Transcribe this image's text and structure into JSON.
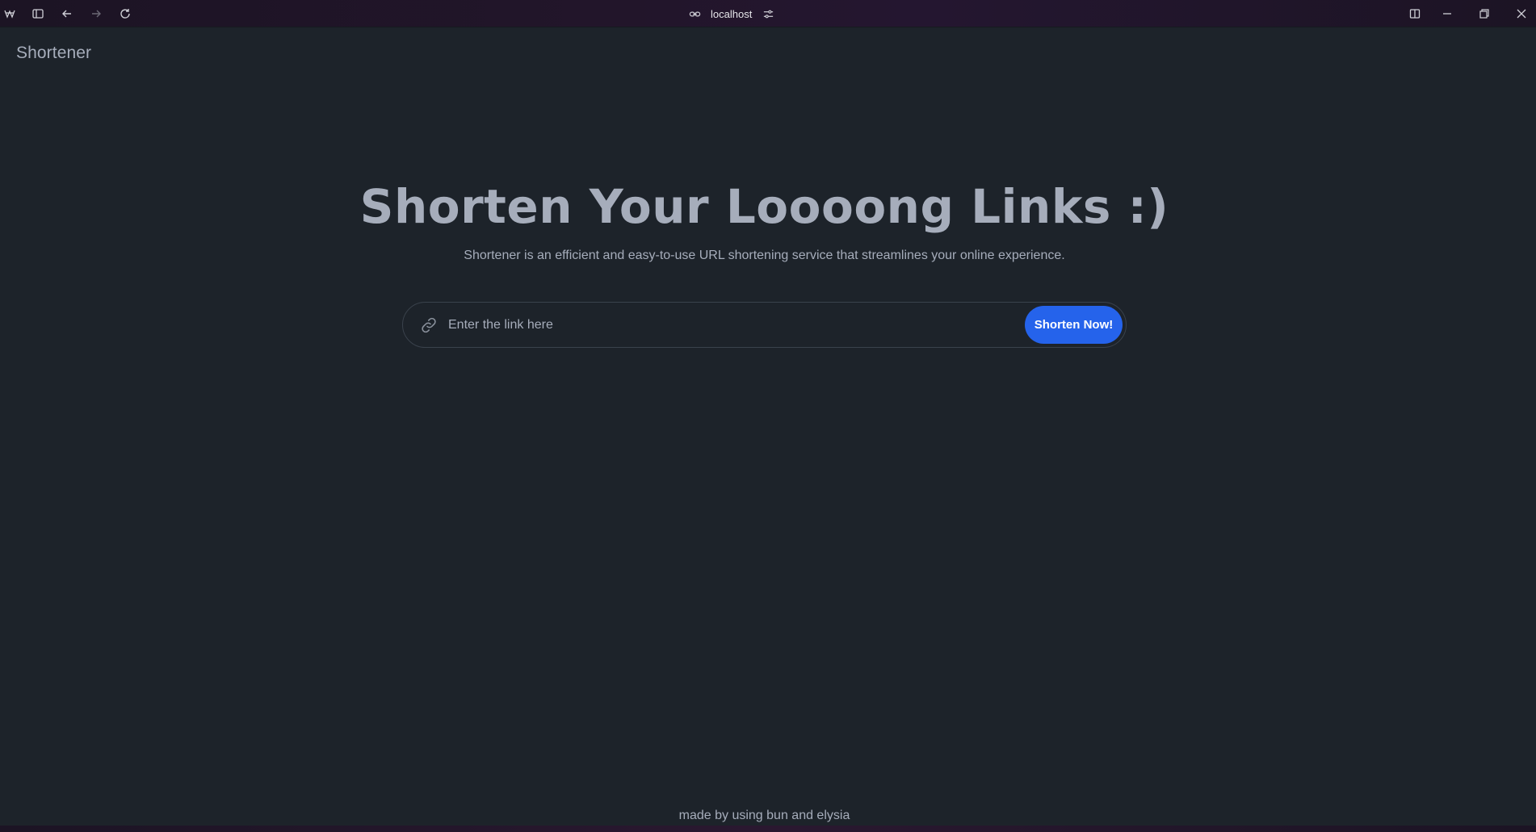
{
  "browser": {
    "url": "localhost",
    "icons": {
      "app": "browser-logo-icon",
      "sidebar": "sidebar-toggle-icon",
      "back": "arrow-left-icon",
      "forward": "arrow-right-icon",
      "reload": "reload-icon",
      "link": "link-icon",
      "site_settings": "sliders-icon",
      "split": "split-view-icon",
      "minimize": "minimize-icon",
      "restore": "restore-icon",
      "close": "close-icon"
    }
  },
  "header": {
    "brand": "Shortener"
  },
  "hero": {
    "title": "Shorten Your Loooong Links :)",
    "subtitle": "Shortener is an efficient and easy-to-use URL shortening service that streamlines your online experience."
  },
  "form": {
    "input_value": "",
    "input_placeholder": "Enter the link here",
    "submit_label": "Shorten Now!",
    "accent_color": "#2563eb"
  },
  "footer": {
    "text": "made by using bun and elysia"
  }
}
